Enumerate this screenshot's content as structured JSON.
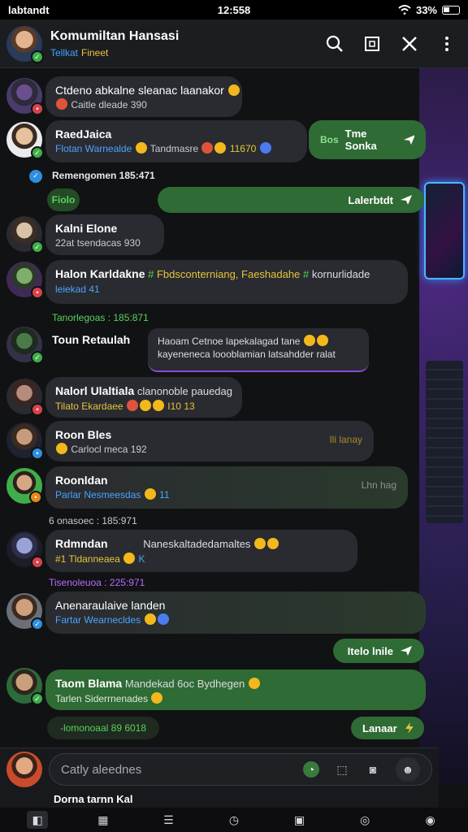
{
  "status": {
    "left": "labtandt",
    "time": "12:558",
    "battery": "33%"
  },
  "header": {
    "title": "Komumiltan Hansasi",
    "sub_a": "Tellkat",
    "sub_b": "Fineet"
  },
  "messages": [
    {
      "name": "Ctdeno abkalne sleanac laanakor",
      "meta": "Caitle dleade 390"
    },
    {
      "name": "RaedJaica",
      "meta": "Flotan Warnealde",
      "meta2": "Tandmasre",
      "meta3": "11670"
    },
    {
      "green_label": "Bos",
      "green_text": "Tme Sonka"
    },
    {
      "timestamp": "Remengomen 185:471"
    },
    {
      "green_label": "Fiolo",
      "green_text": "Lalerbtdt"
    },
    {
      "name": "Kalni Elone",
      "meta": "22at tsendacas 930"
    },
    {
      "name": "Halon Karldakne",
      "txt": "Fbdsconterniang, Faeshadahe",
      "txt2": "kornurlidade",
      "meta": "leiekad 41"
    },
    {
      "timestamp": "Tanorlegoas : 185:871"
    },
    {
      "name": "Toun Retaulah"
    },
    {
      "quote": "Haoam Cetnoe lapekalagad tane",
      "quote2": "kayeneneca loooblamian latsahdder ralat"
    },
    {
      "name": "Nalorl Ulaltiala",
      "txt": "clanonoble pauedag",
      "meta": "Tilato Ekardaee",
      "meta2": "I10 13"
    },
    {
      "name": "Roon Bles",
      "meta": "Carlocl meca 192",
      "tag": "Ili lanay"
    },
    {
      "name": "Roonldan",
      "meta": "Parlar Nesmeesdas",
      "meta2": "11",
      "tag": "Lhn hag"
    },
    {
      "timestamp": "6 onasoec : 185:971"
    },
    {
      "name": "Rdmndan",
      "txt": "Naneskaltadedamaltes",
      "meta": "#1 Tldanneaea",
      "meta2": "K"
    },
    {
      "timestamp": "Tisenoleuoa : 225:971"
    },
    {
      "name": "Anenaraulaive landen",
      "meta": "Fartar Wearnecldes"
    },
    {
      "green_text": "Itelo lnile"
    },
    {
      "name": "Taom Blama",
      "txt": "Mandekad 6oc Bydhegen",
      "meta": "Tarlen Siderrnenades"
    },
    {
      "green_text": "Lanaar"
    },
    {
      "timestamp": "-lomonoaal 89 6018"
    }
  ],
  "input": {
    "placeholder": "Catly aleednes"
  },
  "peek": {
    "name": "Dorna tarnn Kal"
  },
  "colors": {
    "accent_green": "#2f6b34",
    "bubble": "#2a2b30",
    "link_blue": "#3fa2ff",
    "highlight_yellow": "#e8c53a"
  }
}
